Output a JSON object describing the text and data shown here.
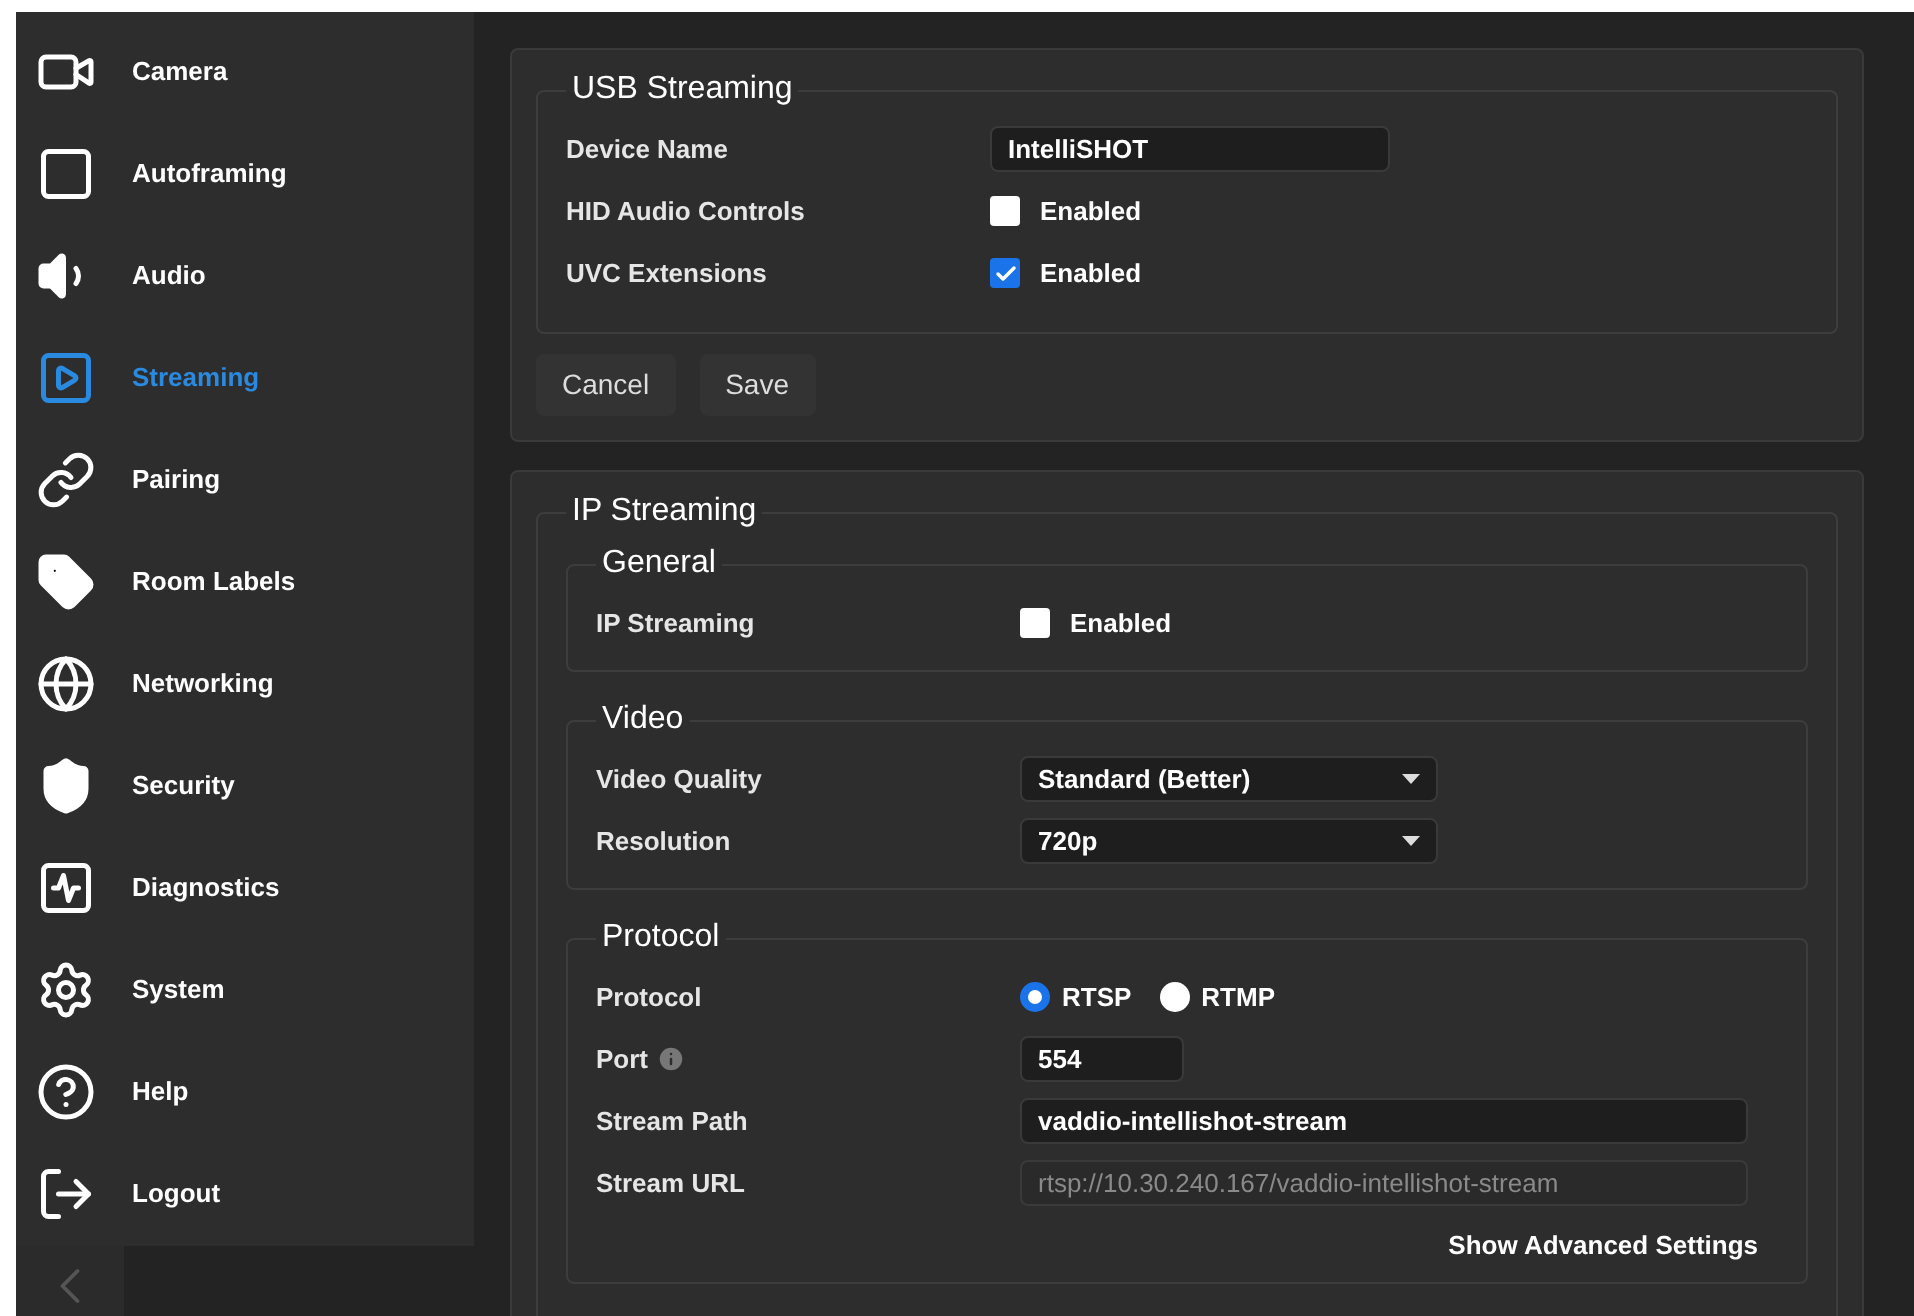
{
  "sidebar": {
    "items": [
      {
        "label": "Camera",
        "selected": false
      },
      {
        "label": "Autoframing",
        "selected": false
      },
      {
        "label": "Audio",
        "selected": false
      },
      {
        "label": "Streaming",
        "selected": true
      },
      {
        "label": "Pairing",
        "selected": false
      },
      {
        "label": "Room Labels",
        "selected": false
      },
      {
        "label": "Networking",
        "selected": false
      },
      {
        "label": "Security",
        "selected": false
      },
      {
        "label": "Diagnostics",
        "selected": false
      },
      {
        "label": "System",
        "selected": false
      },
      {
        "label": "Help",
        "selected": false
      },
      {
        "label": "Logout",
        "selected": false
      }
    ]
  },
  "usb_streaming": {
    "title": "USB Streaming",
    "rows": [
      {
        "kind": "text",
        "label": "Device Name",
        "value": "IntelliSHOT"
      },
      {
        "kind": "checkbox",
        "label": "HID Audio Controls",
        "option": "Enabled",
        "checked": false
      },
      {
        "kind": "checkbox",
        "label": "UVC Extensions",
        "option": "Enabled",
        "checked": true
      }
    ],
    "buttons": [
      "Cancel",
      "Save"
    ]
  },
  "ip_streaming": {
    "title": "IP Streaming",
    "sections": [
      {
        "title": "General",
        "rows": [
          {
            "kind": "checkbox",
            "label": "IP Streaming",
            "option": "Enabled",
            "checked": false
          }
        ]
      },
      {
        "title": "Video",
        "rows": [
          {
            "kind": "select",
            "label": "Video Quality",
            "value": "Standard (Better)"
          },
          {
            "kind": "select",
            "label": "Resolution",
            "value": "720p"
          }
        ]
      },
      {
        "title": "Protocol",
        "rows": [
          {
            "kind": "radio",
            "label": "Protocol",
            "options": [
              {
                "label": "RTSP",
                "selected": true
              },
              {
                "label": "RTMP",
                "selected": false
              }
            ]
          },
          {
            "kind": "short",
            "label": "Port",
            "info": true,
            "value": "554"
          },
          {
            "kind": "text",
            "label": "Stream Path",
            "value": "vaddio-intellishot-stream"
          },
          {
            "kind": "readonly",
            "label": "Stream URL",
            "value": "rtsp://10.30.240.167/vaddio-intellishot-stream"
          }
        ],
        "link": "Show Advanced Settings"
      }
    ]
  }
}
